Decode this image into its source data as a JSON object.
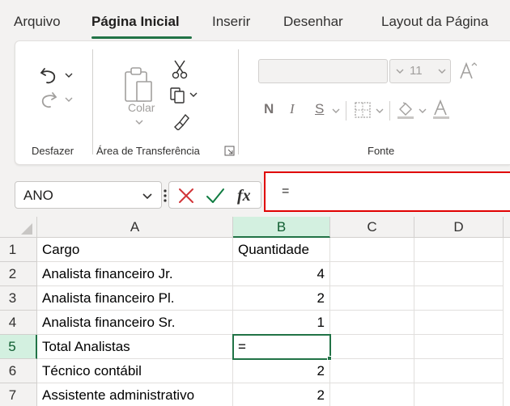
{
  "menu": {
    "tabs": [
      {
        "label": "Arquivo",
        "active": false
      },
      {
        "label": "Página Inicial",
        "active": true
      },
      {
        "label": "Inserir",
        "active": false
      },
      {
        "label": "Desenhar",
        "active": false
      },
      {
        "label": "Layout da Página",
        "active": false
      }
    ]
  },
  "ribbon": {
    "undo_group_label": "Desfazer",
    "clipboard": {
      "paste_label": "Colar",
      "group_label": "Área de Transferência"
    },
    "font": {
      "size_value": "11",
      "bold_label": "N",
      "italic_label": "I",
      "underline_label": "S",
      "group_label": "Fonte"
    }
  },
  "formula_bar": {
    "name_box": "ANO",
    "formula": "=",
    "highlight_color": "#e00000"
  },
  "sheet": {
    "columns": [
      "A",
      "B",
      "C",
      "D"
    ],
    "selected_column": "B",
    "selected_row": "5",
    "rows": [
      {
        "num": "1",
        "a": "Cargo",
        "b": "Quantidade"
      },
      {
        "num": "2",
        "a": "Analista financeiro Jr.",
        "b": "4"
      },
      {
        "num": "3",
        "a": "Analista financeiro Pl.",
        "b": "2"
      },
      {
        "num": "4",
        "a": "Analista financeiro Sr.",
        "b": "1"
      },
      {
        "num": "5",
        "a": "Total Analistas",
        "b": "="
      },
      {
        "num": "6",
        "a": "Técnico contábil",
        "b": "2"
      },
      {
        "num": "7",
        "a": "Assistente administrativo",
        "b": "2"
      }
    ]
  },
  "colors": {
    "accent": "#217346",
    "selected_header_bg": "#d3f0e0"
  }
}
